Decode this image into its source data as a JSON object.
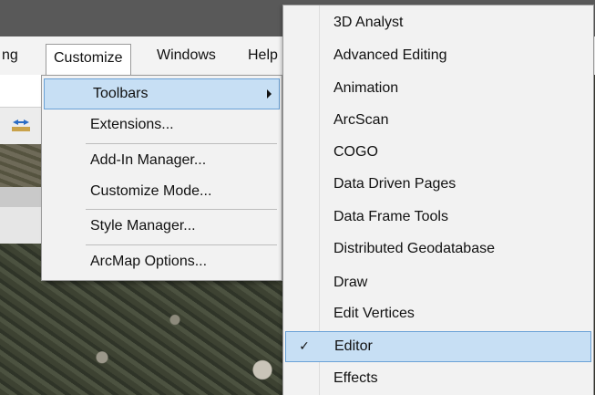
{
  "menubar": {
    "items": [
      {
        "label": "ng"
      },
      {
        "label": "Customize"
      },
      {
        "label": "Windows"
      },
      {
        "label": "Help"
      }
    ]
  },
  "customize_menu": {
    "items": [
      {
        "label": "Toolbars",
        "has_submenu": true
      },
      {
        "label": "Extensions..."
      },
      {
        "label": "Add-In Manager..."
      },
      {
        "label": "Customize Mode..."
      },
      {
        "label": "Style Manager..."
      },
      {
        "label": "ArcMap Options..."
      }
    ]
  },
  "toolbars_submenu": {
    "items": [
      {
        "label": "3D Analyst"
      },
      {
        "label": "Advanced Editing"
      },
      {
        "label": "Animation"
      },
      {
        "label": "ArcScan"
      },
      {
        "label": "COGO"
      },
      {
        "label": "Data Driven Pages"
      },
      {
        "label": "Data Frame Tools"
      },
      {
        "label": "Distributed Geodatabase"
      },
      {
        "label": "Draw"
      },
      {
        "label": "Edit Vertices"
      },
      {
        "label": "Editor",
        "checked": true,
        "check_glyph": "✓"
      },
      {
        "label": "Effects"
      }
    ]
  },
  "colors": {
    "highlight_fill": "#c7dff4",
    "highlight_border": "#6aa1d6",
    "menu_bg": "#f2f2f2"
  }
}
